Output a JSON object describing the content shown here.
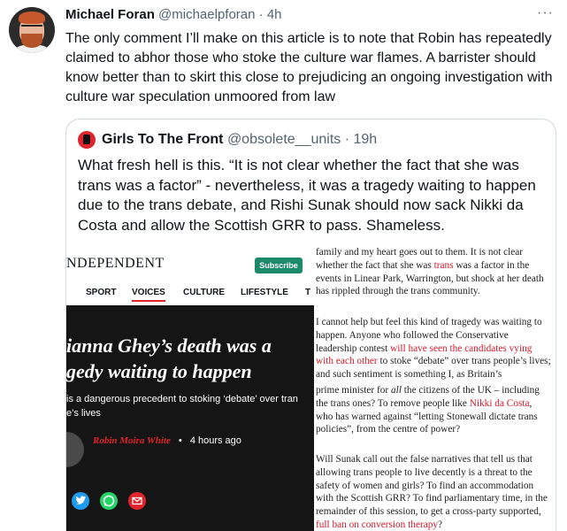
{
  "tweet": {
    "author_name": "Michael Foran",
    "handle": "@michaelpforan",
    "separator": "·",
    "time": "4h",
    "more": "···",
    "text": "The only comment I’ll make on this article is to note that Robin has repeatedly claimed to abhor those who stoke the culture war flames. A barrister should know better than to skirt this close to prejudicing an ongoing investigation with culture war speculation unmoored from law"
  },
  "quote": {
    "author_name": "Girls To The Front",
    "handle": "@obsolete__units",
    "separator": "·",
    "time": "19h",
    "text": "What fresh hell is this. “It is not clear whether the fact that she was trans was a factor” - nevertheless, it was a tragedy waiting to happen due to the trans debate, and Rishi Sunak should now sack Nikki da Costa and allow the Scottish GRR to pass. Shameless."
  },
  "article": {
    "brand": "NDEPENDENT",
    "subscribe_label": "Subscribe",
    "nav": [
      "SPORT",
      "VOICES",
      "CULTURE",
      "LIFESTYLE",
      "T"
    ],
    "headline_line1": "ianna Ghey’s death was a",
    "headline_line2": "gedy waiting to happen",
    "standfirst_line1": "is a dangerous precedent to stoking ‘debate’ over tran",
    "standfirst_line2": "e’s lives",
    "author": "Robin Moira White",
    "bullet": "•",
    "time": "4 hours ago",
    "share_icons": [
      "twitter-icon",
      "whatsapp-icon",
      "email-icon"
    ]
  },
  "body": {
    "p1_a": "family and my heart goes out to them. It is not clear whether the fact that she was ",
    "p1_trans": "trans",
    "p1_b": " was a factor in the events in Linear Park, Warrington, but shock at her death has rippled through the trans community.",
    "p2_a": "I cannot help but feel this kind of tragedy was waiting to happen. Anyone who followed the Conservative leadership contest ",
    "p2_link": "will have seen the candidates vying with each other",
    "p2_b": " to stoke “debate” over trans people’s lives; and such sentiment is something I, as Britain’s",
    "p3_a": "prime minister for ",
    "p3_all": "all",
    "p3_b": " the citizens of the UK – including the trans ones? To remove people like ",
    "p3_link": "Nikki da Costa",
    "p3_c": ", who has warned against “letting Stonewall dictate trans policies”, from the centre of power?",
    "p4_a": "Will Sunak call out the false narratives that tell us that allowing trans people to live decently is a threat to the safety of women and girls? To find an accommodation with the Scottish GRR? To find parliamentary time, in the remainder of this session, to get a cross-party supported, ",
    "p4_link": "full ban on conversion therapy",
    "p4_b": "?"
  },
  "colors": {
    "accent_red": "#e0242b",
    "subscribe_green": "#1b8a6b",
    "twitter_blue": "#1d9bf0",
    "whatsapp_green": "#25d366",
    "email_red": "#e0242b"
  }
}
